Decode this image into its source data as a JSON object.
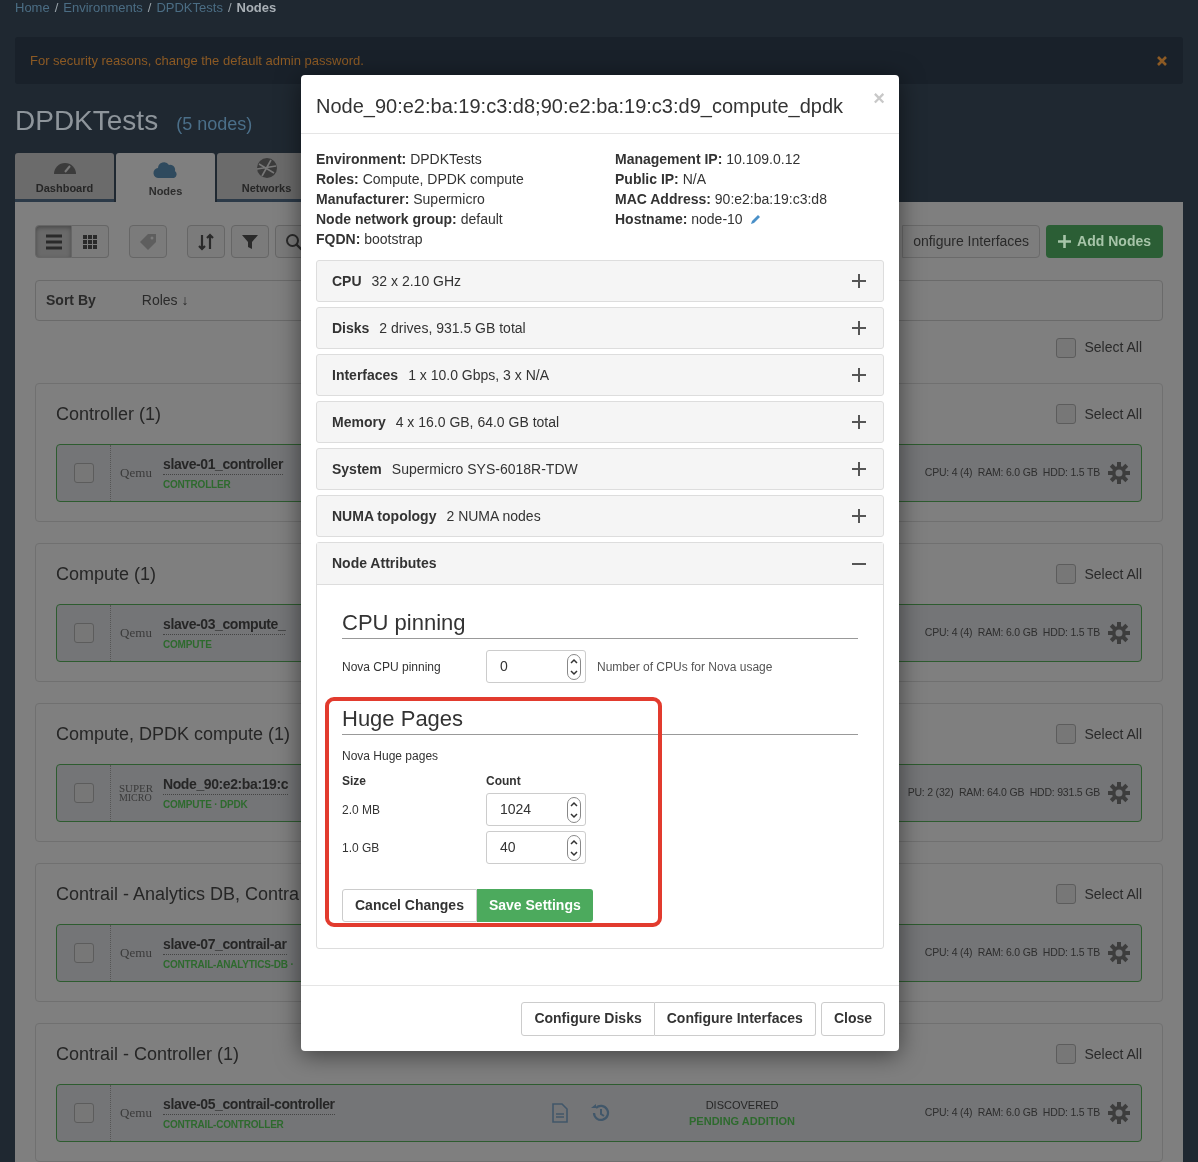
{
  "breadcrumbs": [
    {
      "label": "Home",
      "current": false
    },
    {
      "separator": "/",
      "label": "Environments",
      "current": false
    },
    {
      "separator": "/",
      "label": "DPDKTests",
      "current": false
    },
    {
      "separator": "/",
      "label": "Nodes",
      "current": true
    }
  ],
  "alert": {
    "text": "For security reasons, change the default admin password."
  },
  "environment": {
    "title": "DPDKTests",
    "count": "(5 nodes)"
  },
  "tabs": [
    {
      "kind": "dashboard",
      "label": "Dashboard",
      "selected": false
    },
    {
      "kind": "nodes",
      "label": "Nodes",
      "selected": true
    },
    {
      "kind": "networks",
      "label": "Networks",
      "selected": false
    }
  ],
  "toolbar": {
    "view_buttons": [
      {
        "kind": "list",
        "selected": true
      },
      {
        "kind": "grid",
        "selected": false
      }
    ],
    "configure_interfaces": "onfigure Interfaces",
    "add_nodes": "Add Nodes"
  },
  "sort": {
    "label": "Sort By",
    "field": "Roles ↓"
  },
  "select_all": {
    "label": "Select All",
    "checked": false
  },
  "groups": [
    {
      "title": "Controller (1)",
      "select_all": {
        "label": "Select All",
        "checked": false
      },
      "nodes": [
        {
          "checked": false,
          "vendor": {
            "kind": "qemu",
            "text": "Qemu"
          },
          "name": "slave-01_controller",
          "roles": "CONTROLLER",
          "specs": "CPU: 4 (4)  RAM: 6.0 GB  HDD: 1.5 TB"
        }
      ]
    },
    {
      "title": "Compute (1)",
      "select_all": {
        "label": "Select All",
        "checked": false
      },
      "nodes": [
        {
          "checked": false,
          "vendor": {
            "kind": "qemu",
            "text": "Qemu"
          },
          "name": "slave-03_compute_",
          "roles": "COMPUTE",
          "specs": "CPU: 4 (4)  RAM: 6.0 GB  HDD: 1.5 TB"
        }
      ]
    },
    {
      "title": "Compute, DPDK compute (1)",
      "select_all": {
        "label": "Select All",
        "checked": false
      },
      "nodes": [
        {
          "checked": false,
          "vendor": {
            "kind": "supermicro",
            "lines": [
              "SUPER",
              "MICRO"
            ]
          },
          "name": "Node_90:e2:ba:19:c",
          "roles": "COMPUTE · DPDK",
          "specs": "PU: 2 (32)  RAM: 64.0 GB  HDD: 931.5 GB"
        }
      ]
    },
    {
      "title": "Contrail - Analytics DB, Contra",
      "select_all": {
        "label": "Select All",
        "checked": false
      },
      "nodes": [
        {
          "checked": false,
          "vendor": {
            "kind": "qemu",
            "text": "Qemu"
          },
          "name": "slave-07_contrail-ar",
          "roles": "CONTRAIL-ANALYTICS-DB ·",
          "specs": "CPU: 4 (4)  RAM: 6.0 GB  HDD: 1.5 TB"
        }
      ]
    },
    {
      "title": "Contrail - Controller (1)",
      "select_all": {
        "label": "Select All",
        "checked": false
      },
      "nodes": [
        {
          "checked": false,
          "vendor": {
            "kind": "qemu",
            "text": "Qemu"
          },
          "name": "slave-05_contrail-controller",
          "roles": "CONTRAIL-CONTROLLER",
          "specs": "CPU: 4 (4)  RAM: 6.0 GB  HDD: 1.5 TB",
          "status": {
            "state": "DISCOVERED",
            "detail": "PENDING ADDITION"
          }
        }
      ]
    }
  ],
  "modal": {
    "title": "Node_90:e2:ba:19:c3:d8;90:e2:ba:19:c3:d9_compute_dpdk",
    "close": "×",
    "info_left": [
      {
        "label": "Environment:",
        "value": "DPDKTests"
      },
      {
        "label": "Roles:",
        "value": "Compute, DPDK compute"
      },
      {
        "label": "Manufacturer:",
        "value": "Supermicro"
      },
      {
        "label": "Node network group:",
        "value": "default"
      },
      {
        "label": "FQDN:",
        "value": "bootstrap"
      }
    ],
    "info_right": [
      {
        "label": "Management IP:",
        "value": "10.109.0.12",
        "editable": false
      },
      {
        "label": "Public IP:",
        "value": "N/A",
        "editable": false
      },
      {
        "label": "MAC Address:",
        "value": "90:e2:ba:19:c3:d8",
        "editable": false
      },
      {
        "label": "Hostname:",
        "value": "node-10",
        "editable": true
      }
    ],
    "sections": [
      {
        "label": "CPU",
        "value": "32 x 2.10 GHz",
        "expanded": false
      },
      {
        "label": "Disks",
        "value": "2 drives, 931.5 GB total",
        "expanded": false
      },
      {
        "label": "Interfaces",
        "value": "1 x 10.0 Gbps, 3 x N/A",
        "expanded": false
      },
      {
        "label": "Memory",
        "value": "4 x 16.0 GB, 64.0 GB total",
        "expanded": false
      },
      {
        "label": "System",
        "value": "Supermicro SYS-6018R-TDW",
        "expanded": false
      },
      {
        "label": "NUMA topology",
        "value": "2 NUMA nodes",
        "expanded": false
      }
    ],
    "node_attributes": {
      "label": "Node Attributes",
      "expanded": true,
      "cpu_pinning": {
        "heading": "CPU pinning",
        "label": "Nova CPU pinning",
        "value": "0",
        "help": "Number of CPUs for Nova usage"
      },
      "huge_pages": {
        "heading": "Huge Pages",
        "highlighted": true,
        "label": "Nova Huge pages",
        "size_header": "Size",
        "count_header": "Count",
        "rows": [
          {
            "size": "2.0 MB",
            "count": "1024"
          },
          {
            "size": "1.0 GB",
            "count": "40"
          }
        ]
      },
      "cancel": "Cancel Changes",
      "save": "Save Settings"
    },
    "footer_buttons": [
      {
        "label": "Configure Disks",
        "kind": "grouped"
      },
      {
        "label": "Configure Interfaces",
        "kind": "grouped"
      },
      {
        "label": "Close",
        "kind": "single"
      }
    ]
  }
}
